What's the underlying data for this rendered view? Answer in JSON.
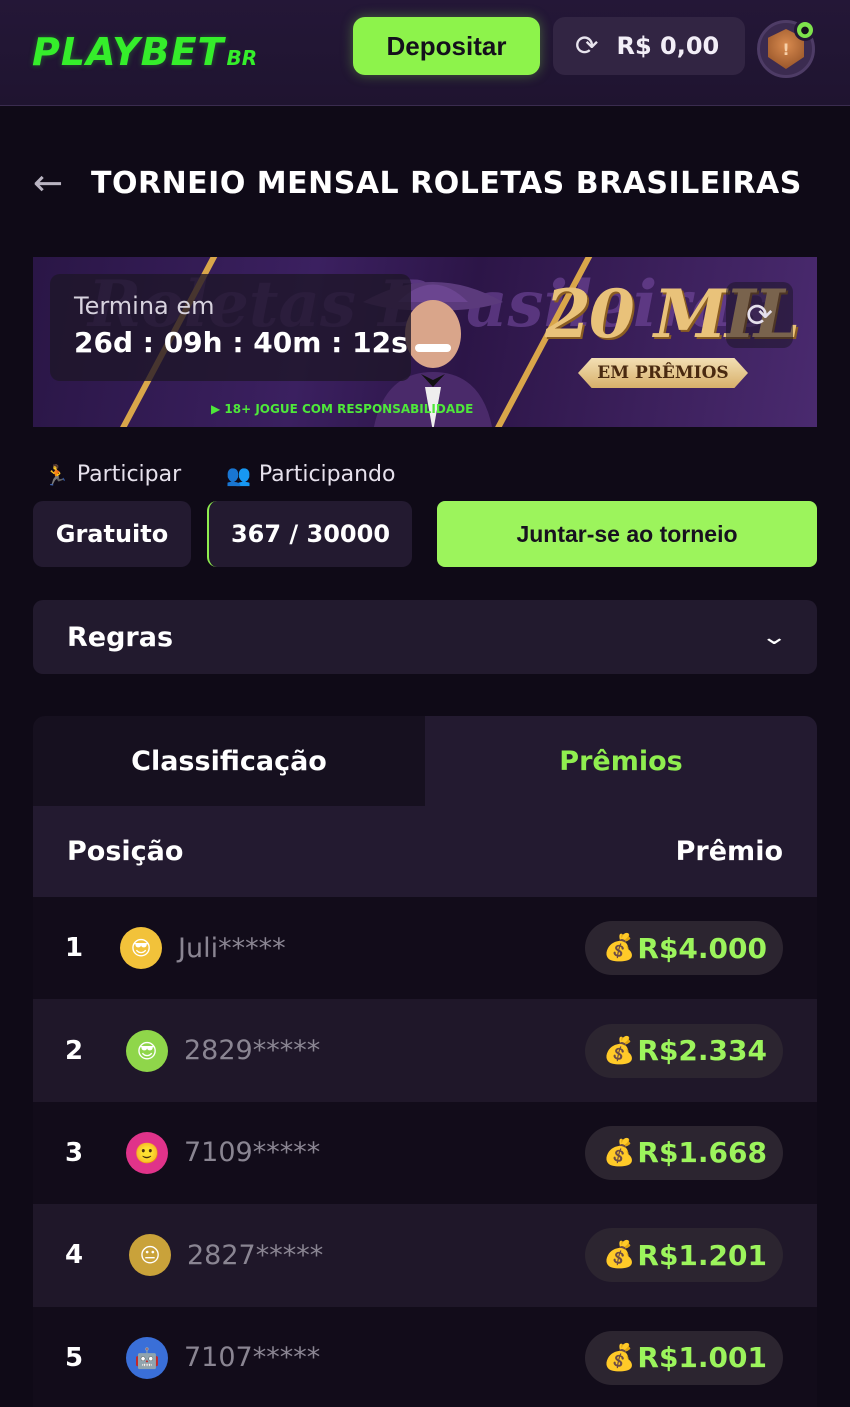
{
  "header": {
    "logo_text": "PLAYBET",
    "logo_suffix": "BR",
    "deposit_label": "Depositar",
    "balance": "R$ 0,00"
  },
  "page": {
    "title": "TORNEIO MENSAL ROLETAS BRASILEIRAS"
  },
  "banner": {
    "bg_text": "Roletas Brasileiras",
    "prize_amount": "20 MIL",
    "prize_sub": "EM PRÊMIOS",
    "disclaimer": "18+ JOGUE COM RESPONSABILIDADE",
    "countdown_label": "Termina em",
    "countdown_value": "26d : 09h : 40m : 12s"
  },
  "participation": {
    "participate_label": "Participar",
    "participating_label": "Participando",
    "entry_value": "Gratuito",
    "participants_value": "367 / 30000",
    "join_label": "Juntar-se ao torneio"
  },
  "rules": {
    "label": "Regras"
  },
  "tabs": [
    {
      "label": "Classificação",
      "active": false
    },
    {
      "label": "Prêmios",
      "active": true
    }
  ],
  "table": {
    "col_position": "Posição",
    "col_prize": "Prêmio",
    "rows": [
      {
        "rank": "1",
        "name": "Juli*****",
        "prize": "R$4.000",
        "avatar_color": "#f2c23a"
      },
      {
        "rank": "2",
        "name": "2829*****",
        "prize": "R$2.334",
        "avatar_color": "#8fd64a"
      },
      {
        "rank": "3",
        "name": "7109*****",
        "prize": "R$1.668",
        "avatar_color": "#e0338a"
      },
      {
        "rank": "4",
        "name": "2827*****",
        "prize": "R$1.201",
        "avatar_color": "#c9a23a"
      },
      {
        "rank": "5",
        "name": "7107*****",
        "prize": "R$1.001",
        "avatar_color": "#3a6fd8"
      }
    ]
  },
  "colors": {
    "accent": "#9cf45c",
    "background": "#0f0a17",
    "logo": "#35ee2b"
  },
  "icons": {
    "back": "arrow-left-icon",
    "refresh": "refresh-icon",
    "participate": "running-person-icon",
    "participating": "users-icon",
    "chevron": "chevron-down-icon",
    "money": "money-bag-icon"
  }
}
